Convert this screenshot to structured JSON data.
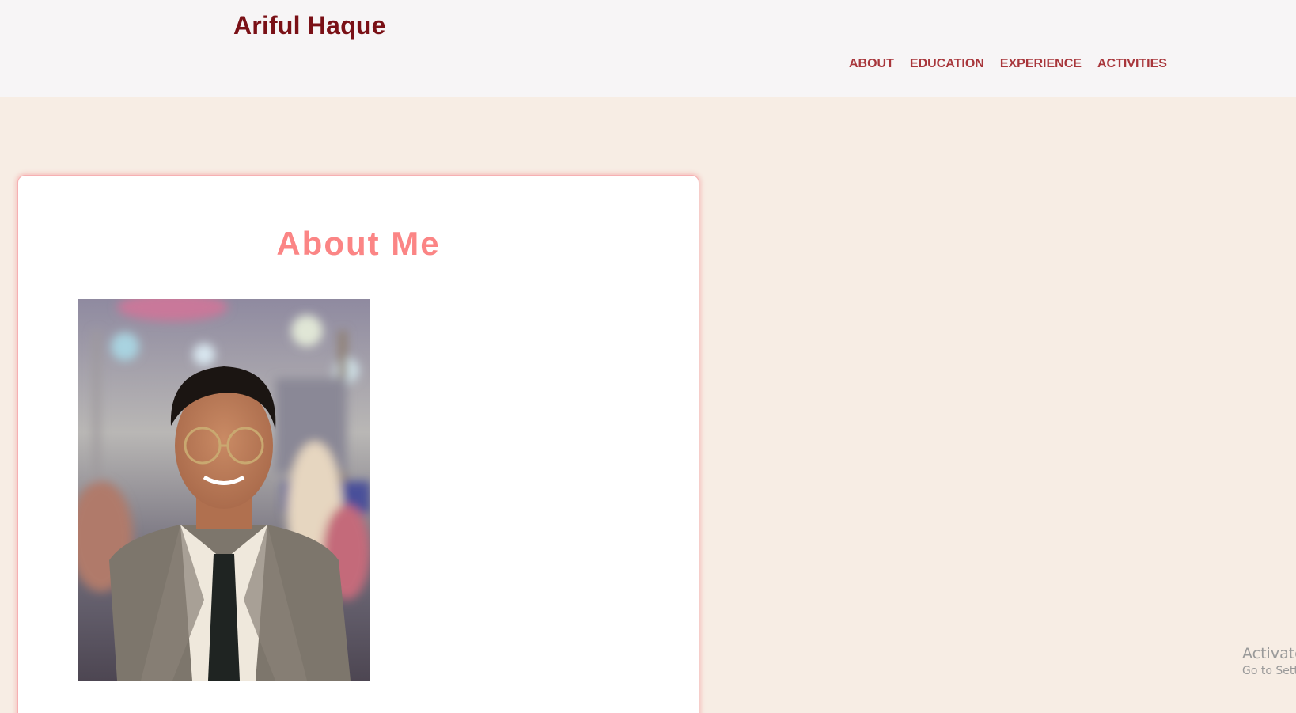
{
  "header": {
    "site_title": "Ariful Haque",
    "nav": [
      {
        "label": "ABOUT"
      },
      {
        "label": "EDUCATION"
      },
      {
        "label": "EXPERIENCE"
      },
      {
        "label": "ACTIVITIES"
      }
    ]
  },
  "about": {
    "heading": "About Me",
    "photo_alt": "Portrait of Ariful Haque"
  },
  "watermark": {
    "line1": "Activate",
    "line2": "Go to Sett"
  },
  "colors": {
    "page_background": "#f7ede4",
    "header_background": "#f7f5f6",
    "title": "#7a1016",
    "nav_link": "#a8363b",
    "heading_accent": "#fb8585",
    "card_border": "#f6b0b2"
  }
}
